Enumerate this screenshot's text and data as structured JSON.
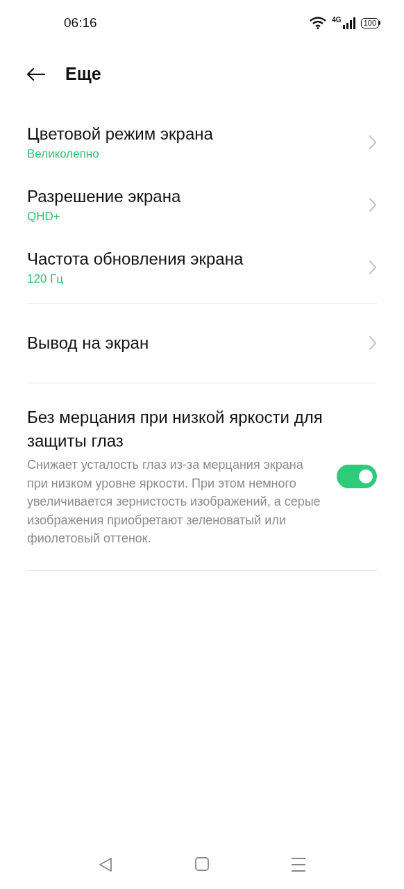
{
  "status_bar": {
    "time": "06:16",
    "network": "4G",
    "battery": "100"
  },
  "header": {
    "title": "Еще"
  },
  "groups": [
    {
      "items": [
        {
          "kind": "link",
          "title": "Цветовой режим экрана",
          "value": "Великолепно"
        },
        {
          "kind": "link",
          "title": "Разрешение экрана",
          "value": "QHD+"
        },
        {
          "kind": "link",
          "title": "Частота обновления экрана",
          "value": "120 Гц"
        }
      ]
    },
    {
      "items": [
        {
          "kind": "link",
          "title": "Вывод на экран"
        }
      ]
    },
    {
      "items": [
        {
          "kind": "toggle",
          "title": "Без мерцания при низкой яркости для защиты глаз",
          "description": "Снижает усталость глаз из-за мерцания экрана при низком уровне яркости. При этом немного увеличивается зернистость изображений, а серые изображения приобретают зеленоватый или фиолетовый оттенок.",
          "on": true
        }
      ]
    }
  ]
}
